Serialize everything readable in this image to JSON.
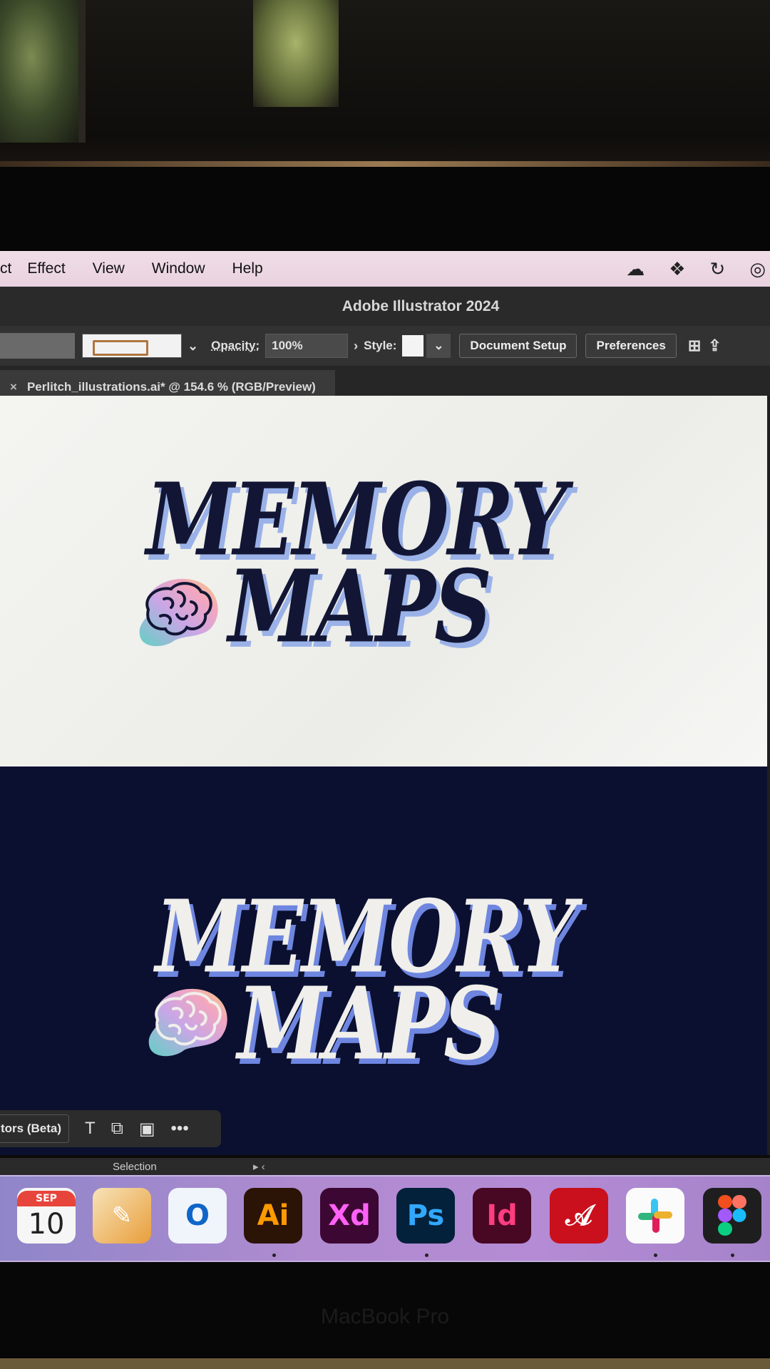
{
  "menubar": {
    "items": [
      "ct",
      "Effect",
      "View",
      "Window",
      "Help"
    ],
    "icons": [
      "cursor-icon",
      "creative-cloud-icon",
      "figma-icon",
      "sync-icon",
      "cc-status-icon"
    ]
  },
  "app": {
    "title": "Adobe Illustrator 2024"
  },
  "control_bar": {
    "opacity_label": "Opacity:",
    "opacity_value": "100%",
    "style_label": "Style:",
    "document_setup": "Document Setup",
    "preferences": "Preferences"
  },
  "document_tab": {
    "close": "×",
    "name": "Perlitch_illustrations.ai* @ 154.6 % (RGB/Preview)"
  },
  "artwork": {
    "line1": "MEMORY",
    "line2": "MAPS",
    "colors": {
      "navy": "#121634",
      "cream": "#f0efeb",
      "shadow_light": "#9ab2e8",
      "shadow_dark": "#6e86e0"
    }
  },
  "context_bar": {
    "label": "tors (Beta)",
    "icons": [
      "text-icon",
      "crop-icon",
      "image-trace-icon",
      "more-icon"
    ]
  },
  "status_bar": {
    "tool": "Selection"
  },
  "dock": {
    "calendar": {
      "month": "SEP",
      "day": "10"
    },
    "apps": [
      "Calendar",
      "Pages",
      "Outlook",
      "Ai",
      "Xd",
      "Ps",
      "Id",
      "Acrobat",
      "Slack",
      "Figma"
    ],
    "labels": {
      "ai": "Ai",
      "xd": "Xd",
      "ps": "Ps",
      "id": "Id"
    }
  },
  "device": {
    "brand": "MacBook Pro"
  }
}
